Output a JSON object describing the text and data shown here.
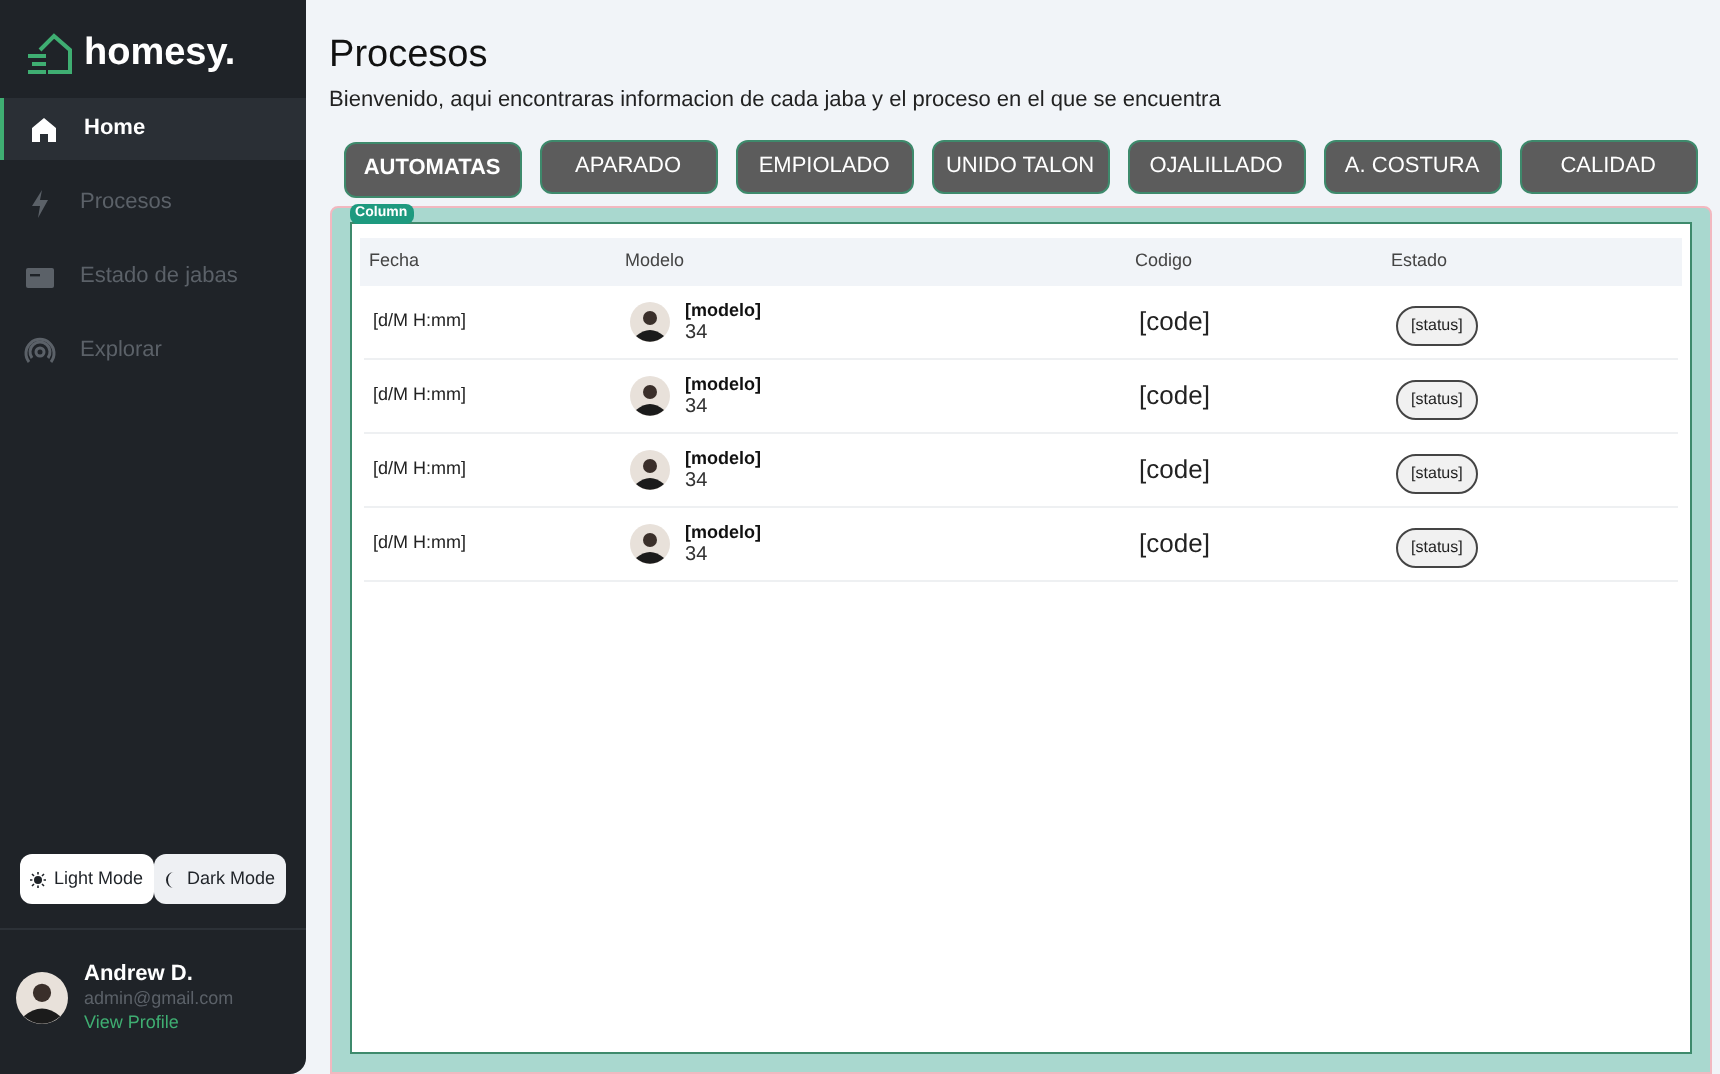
{
  "sidebar": {
    "brand": "homesy.",
    "items": [
      {
        "label": "Home",
        "selected": true
      },
      {
        "label": "Procesos",
        "selected": false
      },
      {
        "label": "Estado de jabas",
        "selected": false
      },
      {
        "label": "Explorar",
        "selected": false
      }
    ],
    "modes": [
      {
        "label": "Light Mode",
        "selected": true
      },
      {
        "label": "Dark Mode",
        "selected": false
      }
    ],
    "user": {
      "name": "Andrew D.",
      "email": "admin@gmail.com",
      "link": "View Profile"
    }
  },
  "header": {
    "title": "Procesos",
    "subtitle": "Bienvenido, aqui encontraras informacion de cada jaba y el proceso en el que se encuentra"
  },
  "tabs": [
    {
      "label": "AUTOMATAS",
      "selected": true
    },
    {
      "label": "APARADO",
      "selected": false
    },
    {
      "label": "EMPIOLADO",
      "selected": false
    },
    {
      "label": "UNIDO TALON",
      "selected": false
    },
    {
      "label": "OJALILLADO",
      "selected": false
    },
    {
      "label": "A. COSTURA",
      "selected": false
    },
    {
      "label": "CALIDAD",
      "selected": false
    }
  ],
  "column_tag": "Column",
  "table": {
    "columns": [
      "Fecha",
      "Modelo",
      "Codigo",
      "Estado"
    ],
    "rows": [
      {
        "fecha": "[d/M H:mm]",
        "modelo": "[modelo]",
        "talla": "34",
        "codigo": "[code]",
        "estado": "[status]"
      },
      {
        "fecha": "[d/M H:mm]",
        "modelo": "[modelo]",
        "talla": "34",
        "codigo": "[code]",
        "estado": "[status]"
      },
      {
        "fecha": "[d/M H:mm]",
        "modelo": "[modelo]",
        "talla": "34",
        "codigo": "[code]",
        "estado": "[status]"
      },
      {
        "fecha": "[d/M H:mm]",
        "modelo": "[modelo]",
        "talla": "34",
        "codigo": "[code]",
        "estado": "[status]"
      }
    ]
  }
}
